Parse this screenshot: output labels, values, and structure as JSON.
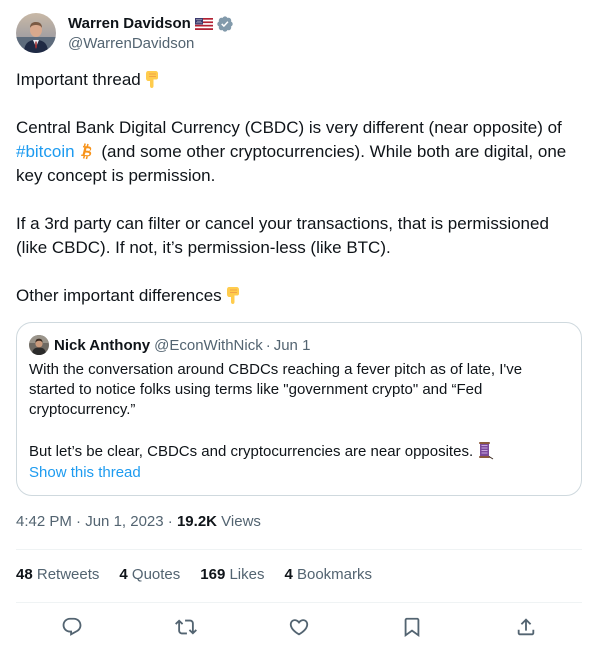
{
  "author": {
    "name": "Warren Davidson",
    "handle": "@WarrenDavidson",
    "flag_icon": "us-flag-icon",
    "verified_icon": "verified-badge-icon",
    "verified_color": "#829aab"
  },
  "tweet": {
    "p1": "Important thread",
    "p2_part1": "Central Bank Digital Currency (CBDC) is very different (near opposite) of ",
    "p2_hashtag": "#bitcoin",
    "p2_part2": "  (and some other cryptocurrencies). While both are digital, one key concept is permission.",
    "p3": "If a 3rd party can filter or cancel your transactions, that is permissioned (like CBDC). If not, it’s permission-less (like BTC).",
    "p4": "Other important differences",
    "hashtag_color": "#1d9bf0"
  },
  "quote": {
    "name": "Nick Anthony",
    "handle": "@EconWithNick",
    "separator": "·",
    "date": "Jun 1",
    "text1": "With the conversation around CBDCs reaching a fever pitch as of late, I've started to notice folks using terms like \"government crypto\" and “Fed cryptocurrency.”",
    "text2": "But let’s be clear, CBDCs and cryptocurrencies are near opposites.",
    "show_thread": "Show this thread"
  },
  "meta": {
    "time": "4:42 PM",
    "sep1": " · ",
    "date": "Jun 1, 2023",
    "sep2": " · ",
    "views_count": "19.2K",
    "views_label": " Views"
  },
  "stats": {
    "retweets_n": "48",
    "retweets_l": " Retweets",
    "quotes_n": "4",
    "quotes_l": " Quotes",
    "likes_n": "169",
    "likes_l": " Likes",
    "bookmarks_n": "4",
    "bookmarks_l": " Bookmarks"
  },
  "actions": {
    "reply_icon": "reply-icon",
    "retweet_icon": "retweet-icon",
    "like_icon": "like-icon",
    "bookmark_icon": "bookmark-icon",
    "share_icon": "share-icon",
    "icon_color": "#536471"
  }
}
